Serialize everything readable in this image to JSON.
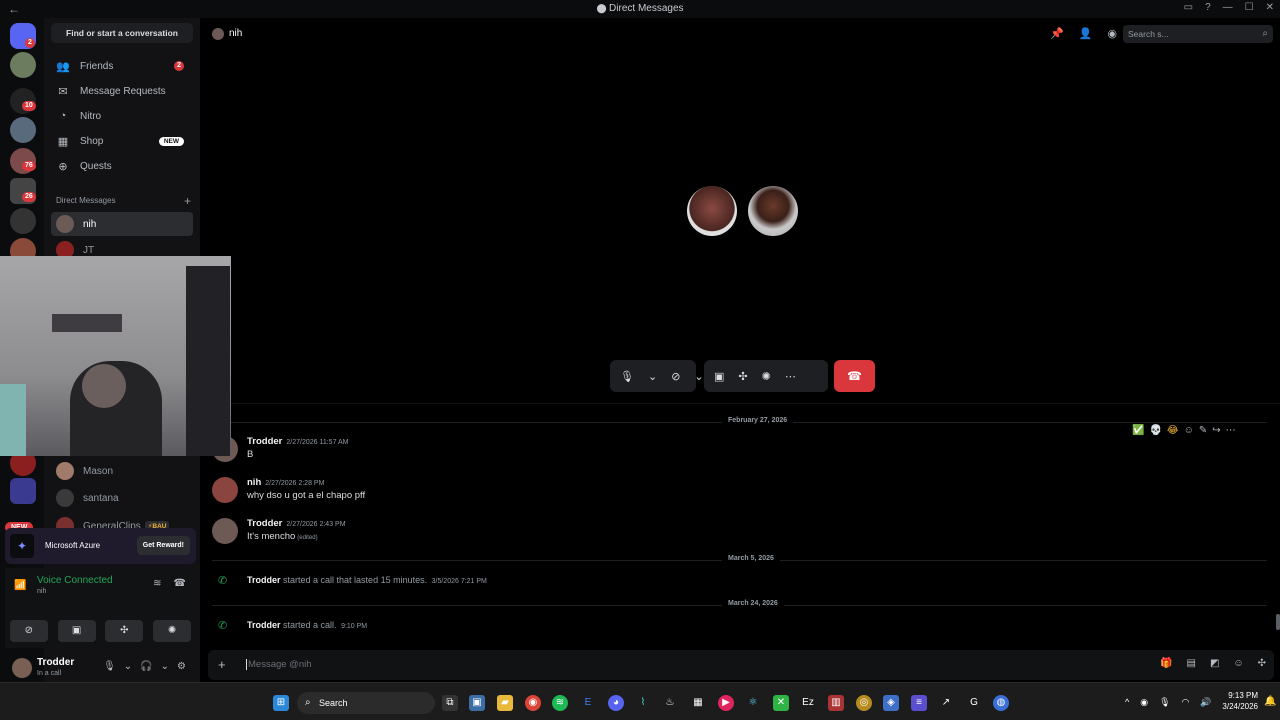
{
  "window": {
    "title": "Direct Messages",
    "back_icon": "←",
    "controls": [
      "▭",
      "?",
      "—",
      "☐",
      "✕"
    ]
  },
  "guilds": {
    "badges": [
      "2",
      "10",
      "76",
      "26"
    ],
    "new_label": "NEW"
  },
  "sidebar": {
    "find_label": "Find or start a conversation",
    "nav": [
      {
        "label": "Friends",
        "icon": "people-icon",
        "count": "2"
      },
      {
        "label": "Message Requests",
        "icon": "envelope-icon"
      },
      {
        "label": "Nitro",
        "icon": "nitro-icon"
      },
      {
        "label": "Shop",
        "icon": "shop-icon",
        "badge": "NEW"
      },
      {
        "label": "Quests",
        "icon": "compass-icon"
      }
    ],
    "dm_header": "Direct Messages",
    "dm_add": "+",
    "dms": [
      {
        "name": "nih",
        "active": true
      },
      {
        "name": "JT"
      },
      {
        "name": "Mason"
      },
      {
        "name": "santana"
      },
      {
        "name": "GeneralClips",
        "tag": "⚡BAU"
      }
    ]
  },
  "promo": {
    "name": "Microsoft Azure",
    "button": "Get Reward!"
  },
  "voice": {
    "status": "Voice Connected",
    "channel": "nih"
  },
  "user": {
    "name": "Trodder",
    "status": "In a call"
  },
  "header": {
    "channel_name": "nih",
    "search_placeholder": "Search s..."
  },
  "chat": {
    "dividers": [
      "February 27, 2026",
      "March 5, 2026",
      "March 24, 2026"
    ],
    "messages": [
      {
        "author": "Trodder",
        "time": "2/27/2026 11:57 AM",
        "text": "B"
      },
      {
        "author": "nih",
        "time": "2/27/2026 2:28 PM",
        "text": "why dso u got a el chapo pff"
      },
      {
        "author": "Trodder",
        "time": "2/27/2026 2:43 PM",
        "text": "It's mencho",
        "edited": "(edited)"
      }
    ],
    "system": [
      {
        "author": "Trodder",
        "text": " started a call that lasted 15 minutes.",
        "time": "3/5/2026 7:21 PM"
      },
      {
        "author": "Trodder",
        "text": " started a call.",
        "time": "9:10 PM"
      }
    ]
  },
  "composer": {
    "placeholder": "Message @nih"
  },
  "taskbar": {
    "search_label": "Search",
    "time": "9:13 PM",
    "date": "3/24/2026"
  },
  "colors": {
    "accent": "#5865f2",
    "danger": "#da373c",
    "online": "#23a55a"
  }
}
